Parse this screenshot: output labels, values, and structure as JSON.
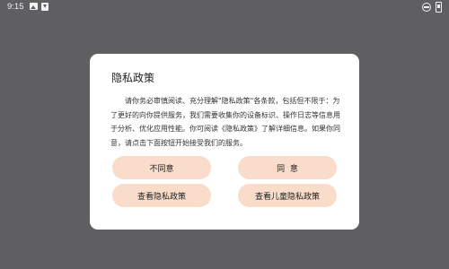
{
  "status_bar": {
    "time": "9:15",
    "icons": [
      "photo-icon",
      "download-icon",
      "do-not-disturb-icon",
      "battery-icon"
    ]
  },
  "dialog": {
    "title": "隐私政策",
    "body": "请你务必审慎阅读、充分理解\"隐私政策\"各条款，包括但不限于：为了更好的向你提供服务，我们需要收集你的设备标识、操作日志等信息用于分析、优化应用性能。你可阅读《隐私政策》了解详细信息。如果你同意，请点击下面按钮开始接受我们的服务。",
    "buttons": {
      "disagree": "不同意",
      "agree": "同  意",
      "view_privacy": "查看隐私政策",
      "view_children_privacy": "查看儿童隐私政策"
    }
  },
  "colors": {
    "overlay": "#5f5f61",
    "dialog_bg": "#ffffff",
    "button_bg": "#f9dcc9"
  }
}
